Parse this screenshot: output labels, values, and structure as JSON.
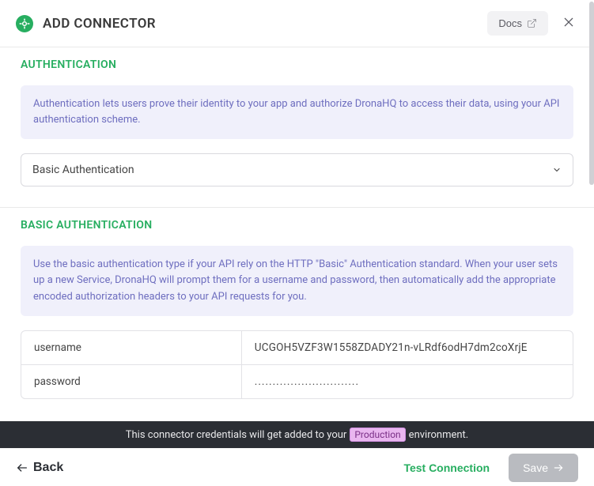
{
  "header": {
    "title": "ADD CONNECTOR",
    "docs_label": "Docs"
  },
  "auth_section": {
    "heading": "AUTHENTICATION",
    "info": "Authentication lets users prove their identity to your app and authorize DronaHQ to access their data, using your API authentication scheme.",
    "selected": "Basic Authentication"
  },
  "basic_section": {
    "heading": "BASIC AUTHENTICATION",
    "info": "Use the basic authentication type if your API rely on the HTTP \"Basic\" Authentication standard. When your user sets up a new Service, DronaHQ will prompt them for a username and password, then automatically add the appropriate encoded authorization headers to your API requests for you.",
    "rows": [
      {
        "label": "username",
        "value": "UCGOH5VZF3W1558ZDADY21n-vLRdf6odH7dm2coXrjE"
      },
      {
        "label": "password",
        "value": "............................."
      }
    ]
  },
  "env_bar": {
    "prefix": "This connector credentials will get added to your",
    "badge": "Production",
    "suffix": "environment."
  },
  "footer": {
    "back": "Back",
    "test": "Test Connection",
    "save": "Save"
  }
}
